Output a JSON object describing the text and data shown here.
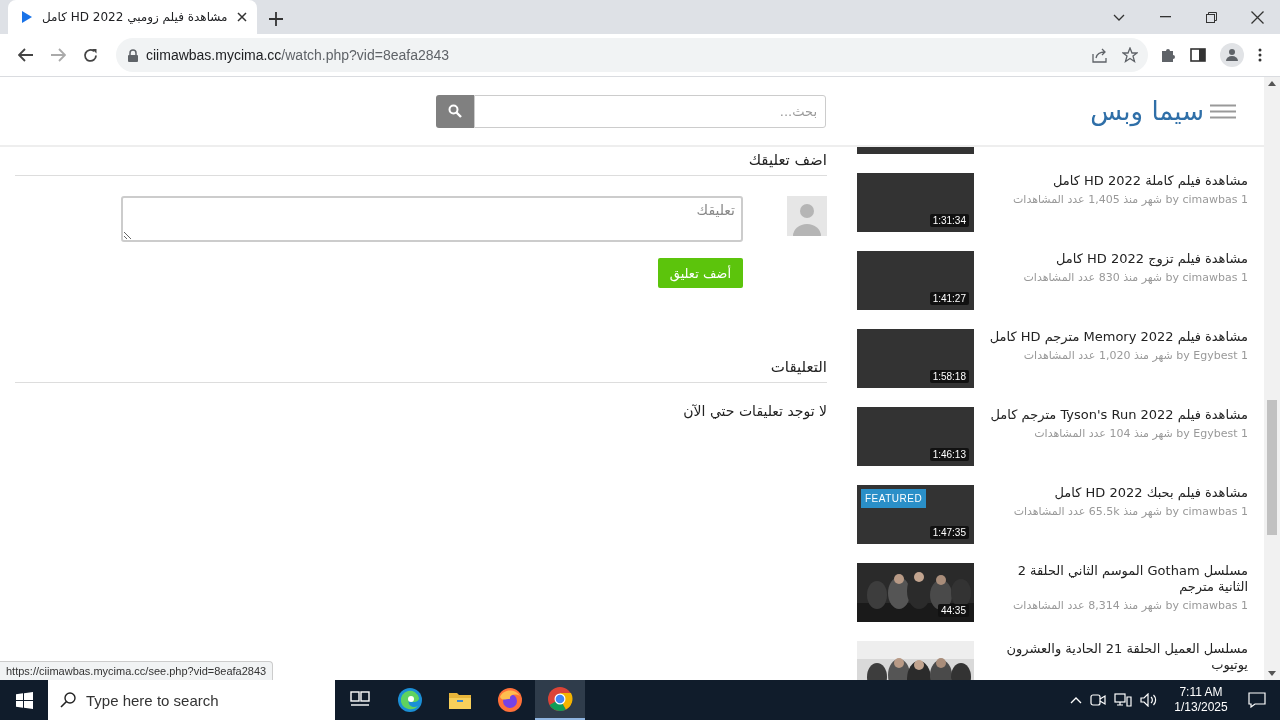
{
  "browser": {
    "tabs": [
      {
        "title": "مشاهدة فيلم زومبي 2022 HD كامل",
        "selected": true
      }
    ],
    "url_host": "ciimawbas.mycima.cc",
    "url_path": "/watch.php?vid=8eafa2843",
    "status_url": "https://ciimawbas.mycima.cc/see.php?vid=8eafa2843"
  },
  "site": {
    "logo": "سيما وبس",
    "search": {
      "placeholder": "بحث..."
    }
  },
  "comment_form": {
    "heading": "اضف تعليقك",
    "placeholder": "تعليقك",
    "button": "أضف تعليق"
  },
  "comments": {
    "heading": "التعليقات",
    "empty_text": "لا توجد تعليقات حتي الآن"
  },
  "sidebar": {
    "videos": [
      {
        "title": "مشاهدة فيلم كاملة 2022 HD كامل",
        "meta": "1 by cimawbas شهر منذ 1,405 عدد المشاهدات",
        "duration": "1:31:34",
        "kind": "dark"
      },
      {
        "title": "مشاهدة فيلم تزوج 2022 HD كامل",
        "meta": "1 by cimawbas شهر منذ 830 عدد المشاهدات",
        "duration": "1:41:27",
        "kind": "dark"
      },
      {
        "title": "مشاهدة فيلم Memory 2022 مترجم HD كامل",
        "meta": "1 by Egybest شهر منذ 1,020 عدد المشاهدات",
        "duration": "1:58:18",
        "kind": "dark"
      },
      {
        "title": "مشاهدة فيلم Tyson's Run 2022 مترجم كامل",
        "meta": "1 by Egybest شهر منذ 104 عدد المشاهدات",
        "duration": "1:46:13",
        "kind": "dark"
      },
      {
        "title": "مشاهدة فيلم بحبك 2022 HD كامل",
        "meta": "1 by cimawbas شهر منذ 65.5k عدد المشاهدات",
        "duration": "1:47:35",
        "kind": "dark",
        "badge": "FEATURED"
      },
      {
        "title": "مسلسل Gotham الموسم الثاني الحلقة 2 الثانية مترجم",
        "meta": "1 by cimawbas شهر منذ 8,314 عدد المشاهدات",
        "duration": "44:35",
        "kind": "picture"
      },
      {
        "title": "مسلسل العميل الحلقة 21 الحادية والعشرون يوتيوب",
        "kind": "picture"
      }
    ]
  },
  "taskbar": {
    "search": {
      "placeholder": "Type here to search"
    },
    "apps": [
      {
        "kind": "task-view",
        "selected": false
      },
      {
        "kind": "edge",
        "selected": false
      },
      {
        "kind": "explorer",
        "selected": false
      },
      {
        "kind": "firefox",
        "selected": false
      },
      {
        "kind": "chrome",
        "selected": true
      }
    ],
    "time": "7:11 AM",
    "date": "1/13/2025"
  }
}
